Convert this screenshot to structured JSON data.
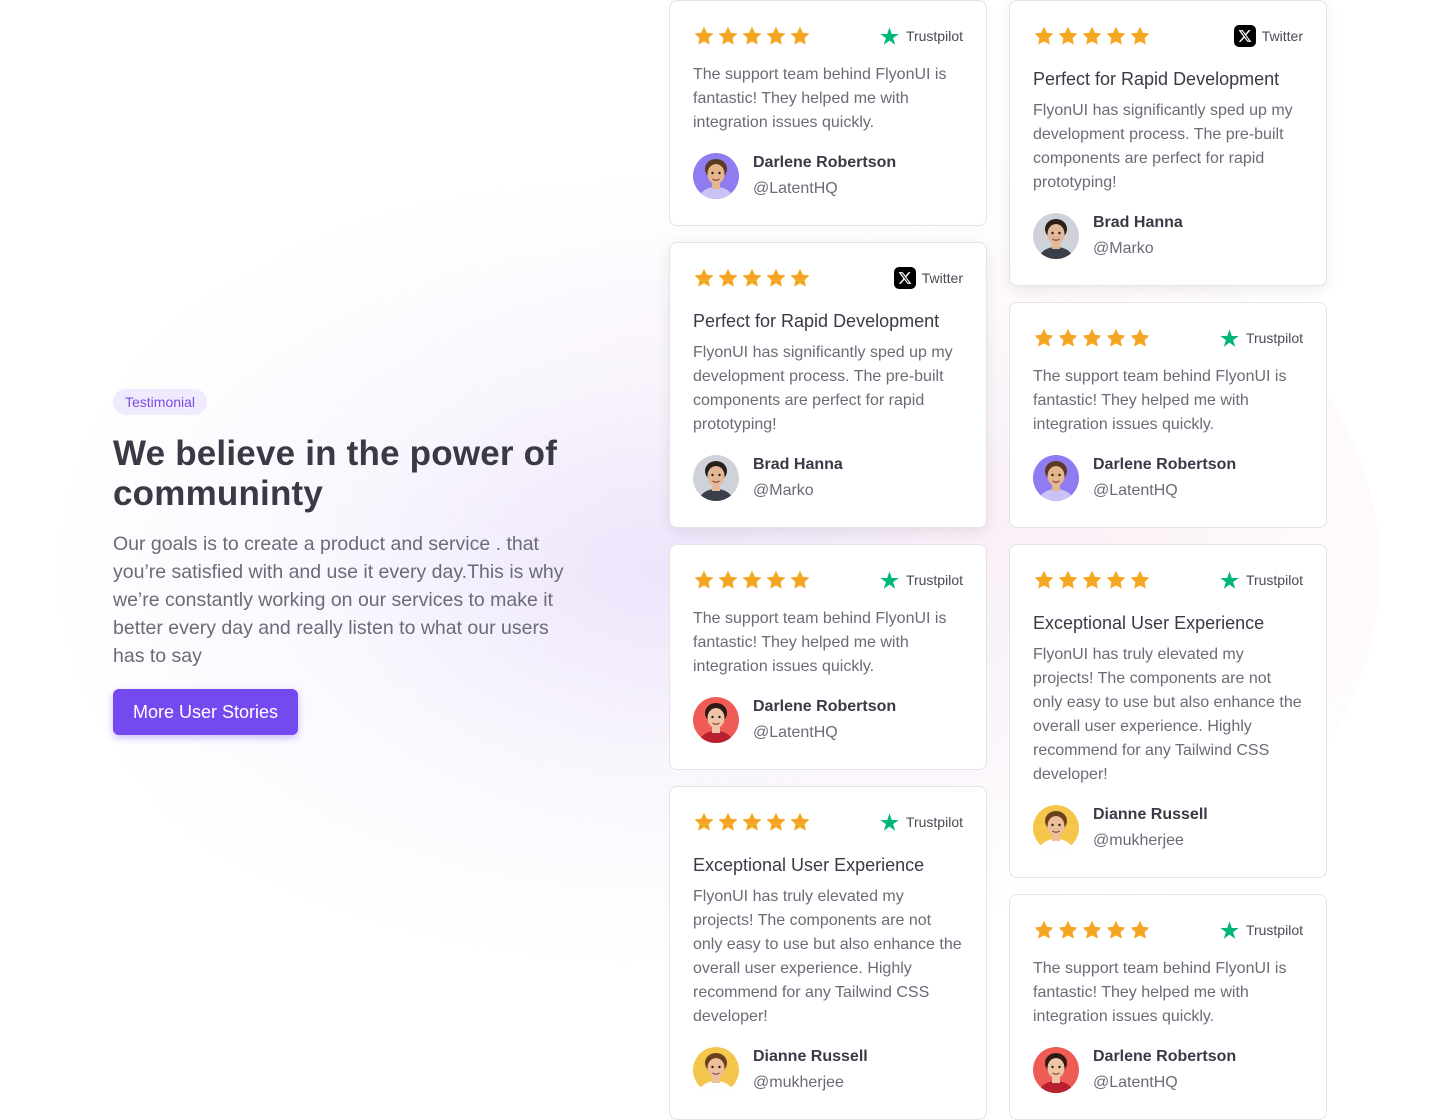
{
  "hero": {
    "badge": "Testimonial",
    "title": "We believe in the power of communinty",
    "description": "Our goals is to create a product and service . that you’re satisfied with and use it every day.This is why we’re constantly working on our services to make it better every day and really listen to what our users has to say",
    "cta_label": "More User Stories"
  },
  "colors": {
    "accent": "#7549f0",
    "star": "#f5a623",
    "trustpilot": "#00b67a",
    "twitter": "#000000"
  },
  "cards": [
    {
      "rating": 5,
      "source": "Trustpilot",
      "source_icon": "trustpilot-star-icon",
      "title": "",
      "text": "The support team behind FlyonUI is fantastic! They helped me with integration issues quickly.",
      "author": "Darlene Robertson",
      "handle": "@LatentHQ",
      "avatar": "avatar-curly-hair-man"
    },
    {
      "rating": 5,
      "source": "Twitter",
      "source_icon": "x-logo-icon",
      "title": "Perfect for Rapid Development",
      "text": "FlyonUI has significantly sped up my development process. The pre-built components are perfect for rapid prototyping!",
      "author": "Brad Hanna",
      "handle": "@Marko",
      "avatar": "avatar-bearded-man"
    },
    {
      "rating": 5,
      "source": "Trustpilot",
      "source_icon": "trustpilot-star-icon",
      "title": "",
      "text": "The support team behind FlyonUI is fantastic! They helped me with integration issues quickly.",
      "author": "Darlene Robertson",
      "handle": "@LatentHQ",
      "avatar": "avatar-red-woman"
    },
    {
      "rating": 5,
      "source": "Trustpilot",
      "source_icon": "trustpilot-star-icon",
      "title": "Exceptional User Experience",
      "text": "FlyonUI has truly elevated my projects! The components are not only easy to use but also enhance the overall user experience. Highly recommend for any Tailwind CSS developer!",
      "author": "Dianne Russell",
      "handle": "@mukherjee",
      "avatar": "avatar-yellow-woman"
    },
    {
      "rating": 5,
      "source": "Twitter",
      "source_icon": "x-logo-icon",
      "title": "Perfect for Rapid Development",
      "text": "FlyonUI has significantly sped up my development process. The pre-built components are perfect for rapid prototyping!",
      "author": "Brad Hanna",
      "handle": "@Marko",
      "avatar": "avatar-bearded-man"
    },
    {
      "rating": 5,
      "source": "Trustpilot",
      "source_icon": "trustpilot-star-icon",
      "title": "",
      "text": "The support team behind FlyonUI is fantastic! They helped me with integration issues quickly.",
      "author": "Darlene Robertson",
      "handle": "@LatentHQ",
      "avatar": "avatar-curly-hair-man"
    },
    {
      "rating": 5,
      "source": "Trustpilot",
      "source_icon": "trustpilot-star-icon",
      "title": "Exceptional User Experience",
      "text": "FlyonUI has truly elevated my projects! The components are not only easy to use but also enhance the overall user experience. Highly recommend for any Tailwind CSS developer!",
      "author": "Dianne Russell",
      "handle": "@mukherjee",
      "avatar": "avatar-yellow-woman"
    },
    {
      "rating": 5,
      "source": "Trustpilot",
      "source_icon": "trustpilot-star-icon",
      "title": "",
      "text": "The support team behind FlyonUI is fantastic! They helped me with integration issues quickly.",
      "author": "Darlene Robertson",
      "handle": "@LatentHQ",
      "avatar": "avatar-red-woman"
    }
  ]
}
